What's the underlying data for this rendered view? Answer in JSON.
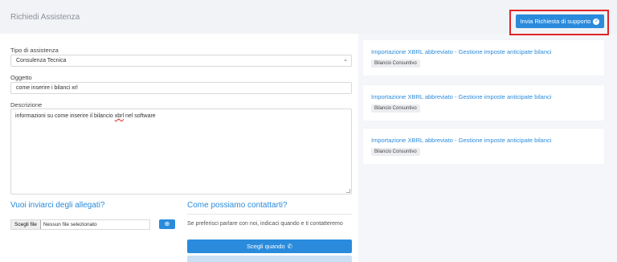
{
  "header": {
    "title": "Richiedi Assistenza",
    "submit_label": "Invia Richiesta di supporto"
  },
  "form": {
    "tipo_label": "Tipo di assistenza",
    "tipo_value": "Consulenza Tecnica",
    "oggetto_label": "Oggetto",
    "oggetto_value": "come inserire i bilanci xrl",
    "descrizione_label": "Descrizione",
    "descrizione_before": "informazioni su come inserire il bilancio ",
    "descrizione_misspelled": "xbrl",
    "descrizione_after": " nel software"
  },
  "attachments": {
    "heading": "Vuoi inviarci degli allegati?",
    "file_button": "Scegli file",
    "file_status": "Nessun file selezionato"
  },
  "contact": {
    "heading": "Come possiamo contattarti?",
    "text": "Se preferisci parlare con noi, indicaci quando e ti contatteremo",
    "button_label": "Scegli quando"
  },
  "suggestions": [
    {
      "title": "Importazione XBRL abbreviato - Gestione imposte anticipate bilanci",
      "tag": "Bilancio Consuntivo"
    },
    {
      "title": "Importazione XBRL abbreviato - Gestione imposte anticipate bilanci",
      "tag": "Bilancio Consuntivo"
    },
    {
      "title": "Importazione XBRL abbreviato - Gestione imposte anticipate bilanci",
      "tag": "Bilancio Consuntivo"
    }
  ],
  "colors": {
    "accent": "#2a8bdc",
    "highlight": "#e3242b"
  }
}
